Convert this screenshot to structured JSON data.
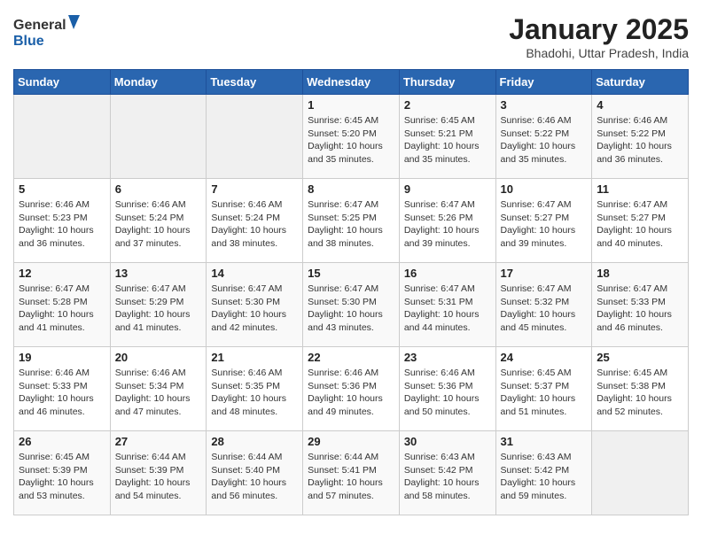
{
  "header": {
    "logo_general": "General",
    "logo_blue": "Blue",
    "title": "January 2025",
    "subtitle": "Bhadohi, Uttar Pradesh, India"
  },
  "weekdays": [
    "Sunday",
    "Monday",
    "Tuesday",
    "Wednesday",
    "Thursday",
    "Friday",
    "Saturday"
  ],
  "weeks": [
    [
      {
        "day": "",
        "sunrise": "",
        "sunset": "",
        "daylight": ""
      },
      {
        "day": "",
        "sunrise": "",
        "sunset": "",
        "daylight": ""
      },
      {
        "day": "",
        "sunrise": "",
        "sunset": "",
        "daylight": ""
      },
      {
        "day": "1",
        "sunrise": "Sunrise: 6:45 AM",
        "sunset": "Sunset: 5:20 PM",
        "daylight": "Daylight: 10 hours and 35 minutes."
      },
      {
        "day": "2",
        "sunrise": "Sunrise: 6:45 AM",
        "sunset": "Sunset: 5:21 PM",
        "daylight": "Daylight: 10 hours and 35 minutes."
      },
      {
        "day": "3",
        "sunrise": "Sunrise: 6:46 AM",
        "sunset": "Sunset: 5:22 PM",
        "daylight": "Daylight: 10 hours and 35 minutes."
      },
      {
        "day": "4",
        "sunrise": "Sunrise: 6:46 AM",
        "sunset": "Sunset: 5:22 PM",
        "daylight": "Daylight: 10 hours and 36 minutes."
      }
    ],
    [
      {
        "day": "5",
        "sunrise": "Sunrise: 6:46 AM",
        "sunset": "Sunset: 5:23 PM",
        "daylight": "Daylight: 10 hours and 36 minutes."
      },
      {
        "day": "6",
        "sunrise": "Sunrise: 6:46 AM",
        "sunset": "Sunset: 5:24 PM",
        "daylight": "Daylight: 10 hours and 37 minutes."
      },
      {
        "day": "7",
        "sunrise": "Sunrise: 6:46 AM",
        "sunset": "Sunset: 5:24 PM",
        "daylight": "Daylight: 10 hours and 38 minutes."
      },
      {
        "day": "8",
        "sunrise": "Sunrise: 6:47 AM",
        "sunset": "Sunset: 5:25 PM",
        "daylight": "Daylight: 10 hours and 38 minutes."
      },
      {
        "day": "9",
        "sunrise": "Sunrise: 6:47 AM",
        "sunset": "Sunset: 5:26 PM",
        "daylight": "Daylight: 10 hours and 39 minutes."
      },
      {
        "day": "10",
        "sunrise": "Sunrise: 6:47 AM",
        "sunset": "Sunset: 5:27 PM",
        "daylight": "Daylight: 10 hours and 39 minutes."
      },
      {
        "day": "11",
        "sunrise": "Sunrise: 6:47 AM",
        "sunset": "Sunset: 5:27 PM",
        "daylight": "Daylight: 10 hours and 40 minutes."
      }
    ],
    [
      {
        "day": "12",
        "sunrise": "Sunrise: 6:47 AM",
        "sunset": "Sunset: 5:28 PM",
        "daylight": "Daylight: 10 hours and 41 minutes."
      },
      {
        "day": "13",
        "sunrise": "Sunrise: 6:47 AM",
        "sunset": "Sunset: 5:29 PM",
        "daylight": "Daylight: 10 hours and 41 minutes."
      },
      {
        "day": "14",
        "sunrise": "Sunrise: 6:47 AM",
        "sunset": "Sunset: 5:30 PM",
        "daylight": "Daylight: 10 hours and 42 minutes."
      },
      {
        "day": "15",
        "sunrise": "Sunrise: 6:47 AM",
        "sunset": "Sunset: 5:30 PM",
        "daylight": "Daylight: 10 hours and 43 minutes."
      },
      {
        "day": "16",
        "sunrise": "Sunrise: 6:47 AM",
        "sunset": "Sunset: 5:31 PM",
        "daylight": "Daylight: 10 hours and 44 minutes."
      },
      {
        "day": "17",
        "sunrise": "Sunrise: 6:47 AM",
        "sunset": "Sunset: 5:32 PM",
        "daylight": "Daylight: 10 hours and 45 minutes."
      },
      {
        "day": "18",
        "sunrise": "Sunrise: 6:47 AM",
        "sunset": "Sunset: 5:33 PM",
        "daylight": "Daylight: 10 hours and 46 minutes."
      }
    ],
    [
      {
        "day": "19",
        "sunrise": "Sunrise: 6:46 AM",
        "sunset": "Sunset: 5:33 PM",
        "daylight": "Daylight: 10 hours and 46 minutes."
      },
      {
        "day": "20",
        "sunrise": "Sunrise: 6:46 AM",
        "sunset": "Sunset: 5:34 PM",
        "daylight": "Daylight: 10 hours and 47 minutes."
      },
      {
        "day": "21",
        "sunrise": "Sunrise: 6:46 AM",
        "sunset": "Sunset: 5:35 PM",
        "daylight": "Daylight: 10 hours and 48 minutes."
      },
      {
        "day": "22",
        "sunrise": "Sunrise: 6:46 AM",
        "sunset": "Sunset: 5:36 PM",
        "daylight": "Daylight: 10 hours and 49 minutes."
      },
      {
        "day": "23",
        "sunrise": "Sunrise: 6:46 AM",
        "sunset": "Sunset: 5:36 PM",
        "daylight": "Daylight: 10 hours and 50 minutes."
      },
      {
        "day": "24",
        "sunrise": "Sunrise: 6:45 AM",
        "sunset": "Sunset: 5:37 PM",
        "daylight": "Daylight: 10 hours and 51 minutes."
      },
      {
        "day": "25",
        "sunrise": "Sunrise: 6:45 AM",
        "sunset": "Sunset: 5:38 PM",
        "daylight": "Daylight: 10 hours and 52 minutes."
      }
    ],
    [
      {
        "day": "26",
        "sunrise": "Sunrise: 6:45 AM",
        "sunset": "Sunset: 5:39 PM",
        "daylight": "Daylight: 10 hours and 53 minutes."
      },
      {
        "day": "27",
        "sunrise": "Sunrise: 6:44 AM",
        "sunset": "Sunset: 5:39 PM",
        "daylight": "Daylight: 10 hours and 54 minutes."
      },
      {
        "day": "28",
        "sunrise": "Sunrise: 6:44 AM",
        "sunset": "Sunset: 5:40 PM",
        "daylight": "Daylight: 10 hours and 56 minutes."
      },
      {
        "day": "29",
        "sunrise": "Sunrise: 6:44 AM",
        "sunset": "Sunset: 5:41 PM",
        "daylight": "Daylight: 10 hours and 57 minutes."
      },
      {
        "day": "30",
        "sunrise": "Sunrise: 6:43 AM",
        "sunset": "Sunset: 5:42 PM",
        "daylight": "Daylight: 10 hours and 58 minutes."
      },
      {
        "day": "31",
        "sunrise": "Sunrise: 6:43 AM",
        "sunset": "Sunset: 5:42 PM",
        "daylight": "Daylight: 10 hours and 59 minutes."
      },
      {
        "day": "",
        "sunrise": "",
        "sunset": "",
        "daylight": ""
      }
    ]
  ]
}
